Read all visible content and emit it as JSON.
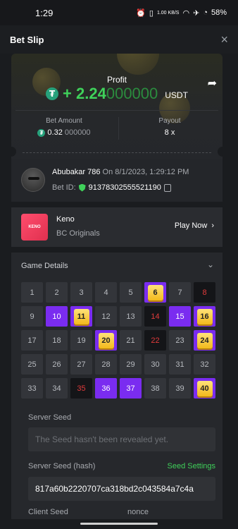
{
  "status_bar": {
    "time": "1:29",
    "net": "1.00 KB/S",
    "battery": "58%"
  },
  "header": {
    "title": "Bet Slip",
    "close_icon": "×"
  },
  "profit": {
    "label": "Profit",
    "sign": "+ ",
    "value_main": "2.24",
    "value_rest": "000000",
    "currency": "USDT",
    "coin": "₮"
  },
  "bet_amount": {
    "label": "Bet Amount",
    "value_main": "0.32",
    "value_rest": "000000"
  },
  "payout": {
    "label": "Payout",
    "value": "8 x"
  },
  "user": {
    "name": "Abubakar 786",
    "on_text": " On 8/1/2023, 1:29:12 PM",
    "betid_label": "Bet ID:",
    "betid": "91378302555521190"
  },
  "game": {
    "name": "Keno",
    "provider": "BC Originals",
    "play_label": "Play Now",
    "thumb_text": "KENO"
  },
  "details": {
    "title": "Game Details",
    "cells": [
      {
        "n": "1",
        "s": "n"
      },
      {
        "n": "2",
        "s": "n"
      },
      {
        "n": "3",
        "s": "n"
      },
      {
        "n": "4",
        "s": "n"
      },
      {
        "n": "5",
        "s": "n"
      },
      {
        "n": "6",
        "s": "h"
      },
      {
        "n": "7",
        "s": "n"
      },
      {
        "n": "8",
        "s": "m"
      },
      {
        "n": "9",
        "s": "n"
      },
      {
        "n": "10",
        "s": "p"
      },
      {
        "n": "11",
        "s": "h"
      },
      {
        "n": "12",
        "s": "n"
      },
      {
        "n": "13",
        "s": "n"
      },
      {
        "n": "14",
        "s": "m"
      },
      {
        "n": "15",
        "s": "p"
      },
      {
        "n": "16",
        "s": "h"
      },
      {
        "n": "17",
        "s": "n"
      },
      {
        "n": "18",
        "s": "n"
      },
      {
        "n": "19",
        "s": "n"
      },
      {
        "n": "20",
        "s": "h"
      },
      {
        "n": "21",
        "s": "n"
      },
      {
        "n": "22",
        "s": "m"
      },
      {
        "n": "23",
        "s": "n"
      },
      {
        "n": "24",
        "s": "h"
      },
      {
        "n": "25",
        "s": "n"
      },
      {
        "n": "26",
        "s": "n"
      },
      {
        "n": "27",
        "s": "n"
      },
      {
        "n": "28",
        "s": "n"
      },
      {
        "n": "29",
        "s": "n"
      },
      {
        "n": "30",
        "s": "n"
      },
      {
        "n": "31",
        "s": "n"
      },
      {
        "n": "32",
        "s": "n"
      },
      {
        "n": "33",
        "s": "n"
      },
      {
        "n": "34",
        "s": "n"
      },
      {
        "n": "35",
        "s": "m"
      },
      {
        "n": "36",
        "s": "p"
      },
      {
        "n": "37",
        "s": "p"
      },
      {
        "n": "38",
        "s": "n"
      },
      {
        "n": "39",
        "s": "n"
      },
      {
        "n": "40",
        "s": "h"
      }
    ],
    "server_seed_label": "Server Seed",
    "server_seed_placeholder": "The Seed hasn't been revealed yet.",
    "server_hash_label": "Server Seed (hash)",
    "seed_settings": "Seed Settings",
    "server_hash": "817a60b2220707ca318bd2c043584a7c4a",
    "client_seed_label": "Client Seed",
    "nonce_label": "nonce"
  },
  "colors": {
    "green": "#3fd15a",
    "purple": "#7a2cf0",
    "gold": "#f3b91b",
    "miss_red": "#e23b3b"
  }
}
